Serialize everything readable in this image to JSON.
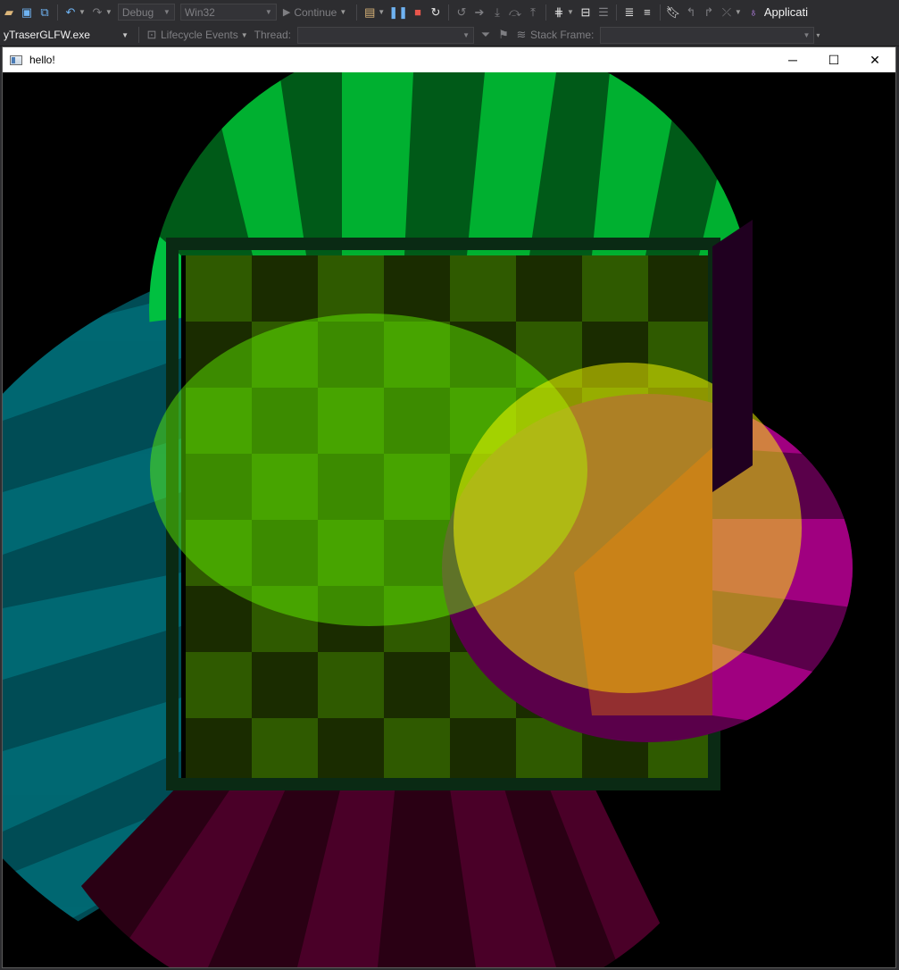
{
  "toolbar": {
    "config_value": "Debug",
    "platform_value": "Win32",
    "continue_label": "Continue",
    "right_label": "Applicati"
  },
  "debugbar": {
    "process_value": "yTraserGLFW.exe",
    "lifecycle_label": "Lifecycle Events",
    "thread_label": "Thread:",
    "thread_value": "",
    "stack_label": "Stack Frame:",
    "stack_value": ""
  },
  "window": {
    "title": "hello!"
  },
  "colors": {
    "vs_bg": "#2d2d30",
    "accent_green": "#00c020",
    "accent_cyan": "#008080",
    "accent_magenta": "#c000a0",
    "accent_yellow": "#e0ff00"
  }
}
